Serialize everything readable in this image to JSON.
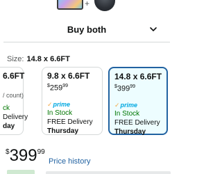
{
  "buy_both": {
    "label": "Buy both"
  },
  "size": {
    "label": "Size:",
    "value": "14.8 x 6.6FT"
  },
  "options": [
    {
      "title": "6.6FT",
      "price_partial": "",
      "sub": "/ count)",
      "stock": "ck",
      "delivery": "Delivery",
      "day": "day",
      "prime": false
    },
    {
      "title": "9.8 x 6.6FT",
      "currency": "$",
      "price_whole": "259",
      "price_cents": "99",
      "prime_label": "prime",
      "stock": "In Stock",
      "delivery": "FREE Delivery",
      "day": "Thursday",
      "prime": true
    },
    {
      "title": "14.8 x 6.6FT",
      "currency": "$",
      "price_whole": "399",
      "price_cents": "99",
      "prime_label": "prime",
      "stock": "In Stock",
      "delivery": "FREE Delivery",
      "day": "Thursday",
      "prime": true,
      "selected": true
    }
  ],
  "price": {
    "currency": "$",
    "whole": "399",
    "cents": "99",
    "history_link": "Price history"
  },
  "colors": {
    "accent_link": "#2162a1",
    "in_stock": "#007600",
    "prime": "#00a8e1",
    "selected_border": "#2162a1",
    "selected_bg": "#edfdff"
  }
}
